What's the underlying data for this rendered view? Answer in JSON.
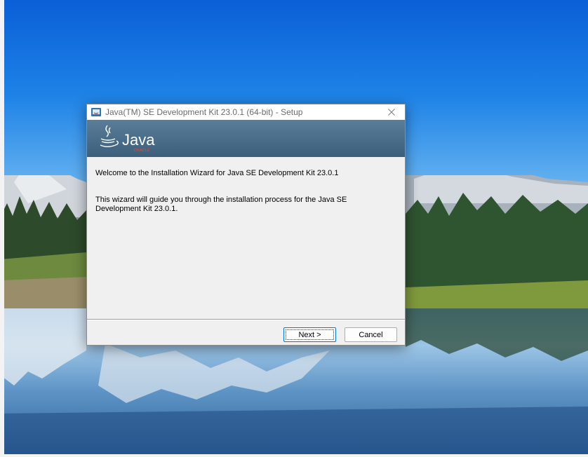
{
  "window": {
    "title": "Java(TM) SE Development Kit 23.0.1 (64-bit) - Setup"
  },
  "banner": {
    "logo_text": "Java",
    "logo_subtext": "ORACLE"
  },
  "content": {
    "welcome_text": "Welcome to the Installation Wizard for Java SE Development Kit 23.0.1",
    "description_text": "This wizard will guide you through the installation process for the Java SE Development Kit 23.0.1."
  },
  "buttons": {
    "next_label": "Next >",
    "cancel_label": "Cancel"
  },
  "colors": {
    "banner": "#4a6d8a",
    "dialog_background": "#f0f0f0",
    "focus_border": "#0078d7"
  },
  "icons": [
    "java-setup-icon",
    "close-icon",
    "java-cup-logo-icon"
  ]
}
